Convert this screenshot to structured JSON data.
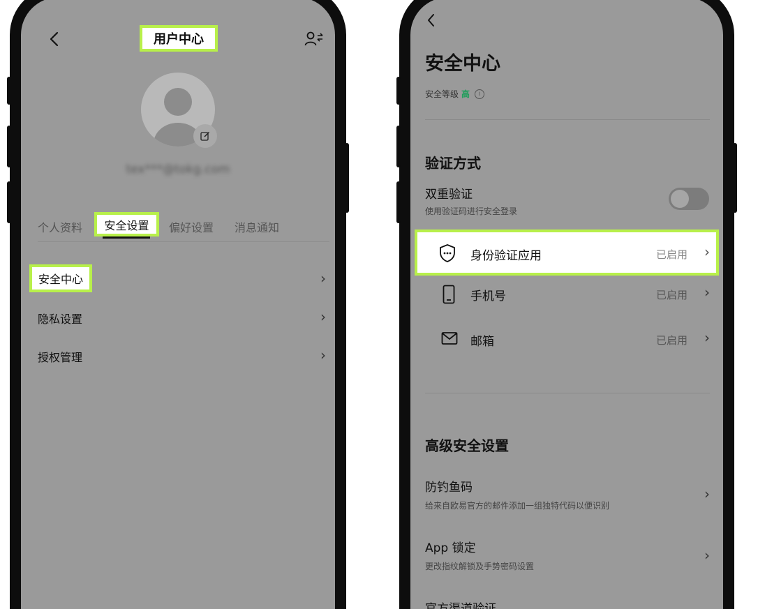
{
  "left": {
    "header": {
      "back_icon": "chevron-left",
      "title": "用户中心",
      "switch_icon": "switch-user-icon"
    },
    "profile": {
      "email": "tex***@tokg.com",
      "edit_icon": "edit-icon"
    },
    "tabs": [
      {
        "label": "个人资料",
        "active": false
      },
      {
        "label": "安全设置",
        "active": true
      },
      {
        "label": "偏好设置",
        "active": false
      },
      {
        "label": "消息通知",
        "active": false
      }
    ],
    "menu": [
      {
        "label": "安全中心",
        "highlighted": true
      },
      {
        "label": "隐私设置"
      },
      {
        "label": "授权管理"
      }
    ]
  },
  "right": {
    "header": {
      "back_icon": "chevron-left",
      "title": "安全中心"
    },
    "security_level": {
      "label": "安全等级",
      "value": "高",
      "value_color": "#1e9e5a"
    },
    "verify": {
      "section_title": "验证方式",
      "two_factor": {
        "title": "双重验证",
        "desc": "使用验证码进行安全登录",
        "enabled": false
      },
      "methods": [
        {
          "icon": "shield-icon",
          "label": "身份验证应用",
          "status": "已启用",
          "highlighted": true
        },
        {
          "icon": "phone-icon",
          "label": "手机号",
          "status": "已启用"
        },
        {
          "icon": "mail-icon",
          "label": "邮箱",
          "status": "已启用"
        }
      ]
    },
    "advanced": {
      "section_title": "高级安全设置",
      "items": [
        {
          "title": "防钓鱼码",
          "desc": "给来自欧易官方的邮件添加一组独特代码以便识别"
        },
        {
          "title": "App 锁定",
          "desc": "更改指纹解锁及手势密码设置"
        },
        {
          "title": "官方渠道验证",
          "desc": ""
        }
      ]
    }
  },
  "colors": {
    "highlight": "#b8f04a",
    "screen_bg": "#9a9a9a",
    "frame": "#0d0d0d"
  }
}
